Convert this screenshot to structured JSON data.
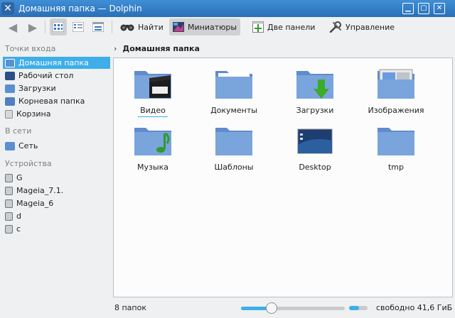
{
  "window": {
    "title": "Домашняя папка — Dolphin",
    "app_icon": "x-icon",
    "controls": [
      "minimize-icon",
      "maximize-icon",
      "close-icon"
    ]
  },
  "toolbar": {
    "back_icon": "arrow-left-icon",
    "forward_icon": "arrow-right-icon",
    "view_modes": [
      "icons-view-icon",
      "details-view-icon",
      "compact-view-icon"
    ],
    "active_view": "icons-view-icon",
    "find_label": "Найти",
    "preview_label": "Миниатюры",
    "split_label": "Две панели",
    "menu_label": "Управление"
  },
  "sidebar": {
    "places_title": "Точки входа",
    "places": [
      {
        "label": "Домашняя папка",
        "icon": "home-folder-icon",
        "selected": true
      },
      {
        "label": "Рабочий стол",
        "icon": "desktop-icon"
      },
      {
        "label": "Загрузки",
        "icon": "downloads-icon"
      },
      {
        "label": "Корневая папка",
        "icon": "root-folder-icon"
      },
      {
        "label": "Корзина",
        "icon": "trash-icon"
      }
    ],
    "network_title": "В сети",
    "network": [
      {
        "label": "Сеть",
        "icon": "network-icon"
      }
    ],
    "devices_title": "Устройства",
    "devices": [
      {
        "label": "G",
        "icon": "drive-icon"
      },
      {
        "label": "Mageia_7.1.",
        "icon": "drive-icon"
      },
      {
        "label": "Mageia_6",
        "icon": "drive-icon"
      },
      {
        "label": "d",
        "icon": "drive-icon"
      },
      {
        "label": "c",
        "icon": "drive-icon"
      }
    ]
  },
  "breadcrumb": {
    "path": "Домашняя папка"
  },
  "files": [
    {
      "label": "Видео",
      "icon": "video-folder-icon"
    },
    {
      "label": "Документы",
      "icon": "documents-folder-icon"
    },
    {
      "label": "Загрузки",
      "icon": "downloads-folder-icon"
    },
    {
      "label": "Изображения",
      "icon": "pictures-folder-icon"
    },
    {
      "label": "Музыка",
      "icon": "music-folder-icon"
    },
    {
      "label": "Шаблоны",
      "icon": "templates-folder-icon"
    },
    {
      "label": "Desktop",
      "icon": "desktop-folder-icon"
    },
    {
      "label": "tmp",
      "icon": "folder-icon"
    }
  ],
  "statusbar": {
    "count": "8 папок",
    "zoom_level": 0.27,
    "free": "свободно 41,6 ГиБ",
    "capacity_used": 0.55
  },
  "colors": {
    "accent": "#3daee9",
    "folder": "#6e9bd4",
    "titlebar": "#3482c9"
  }
}
